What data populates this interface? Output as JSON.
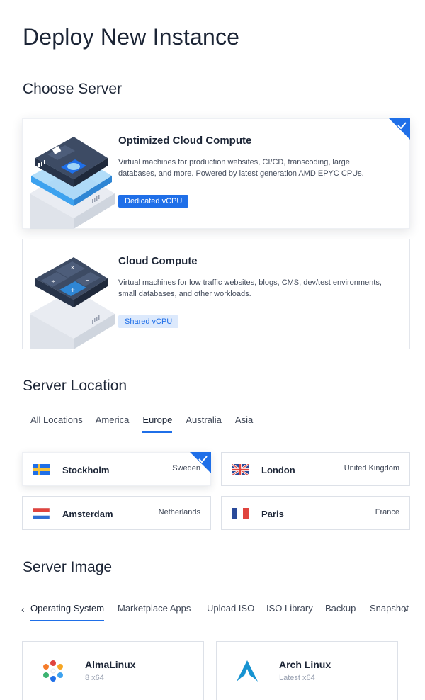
{
  "page": {
    "title": "Deploy New Instance"
  },
  "sections": {
    "server": "Choose Server",
    "location": "Server Location",
    "image": "Server Image"
  },
  "servers": [
    {
      "title": "Optimized Cloud Compute",
      "description": "Virtual machines for production websites, CI/CD, transcoding, large databases, and more. Powered by latest generation AMD EPYC CPUs.",
      "badge": "Dedicated vCPU",
      "selected": true
    },
    {
      "title": "Cloud Compute",
      "description": "Virtual machines for low traffic websites, blogs, CMS, dev/test environments, small databases, and other workloads.",
      "badge": "Shared vCPU",
      "selected": false
    }
  ],
  "location_tabs": [
    "All Locations",
    "America",
    "Europe",
    "Australia",
    "Asia"
  ],
  "location_active_tab": "Europe",
  "locations": [
    {
      "city": "Stockholm",
      "country": "Sweden",
      "flag": "sweden-flag-icon",
      "selected": true
    },
    {
      "city": "London",
      "country": "United Kingdom",
      "flag": "uk-flag-icon",
      "selected": false
    },
    {
      "city": "Amsterdam",
      "country": "Netherlands",
      "flag": "netherlands-flag-icon",
      "selected": false
    },
    {
      "city": "Paris",
      "country": "France",
      "flag": "france-flag-icon",
      "selected": false
    }
  ],
  "image_tabs": [
    "Operating System",
    "Marketplace Apps",
    "Upload ISO",
    "ISO Library",
    "Backup",
    "Snapshot"
  ],
  "image_active_tab": "Operating System",
  "images": [
    {
      "name": "AlmaLinux",
      "version": "8  x64",
      "icon": "almalinux-logo-icon"
    },
    {
      "name": "Arch Linux",
      "version": "Latest  x64",
      "icon": "archlinux-logo-icon"
    }
  ],
  "colors": {
    "accent": "#1f6fe8",
    "text": "#1c2536",
    "muted": "#9aa2b2"
  }
}
